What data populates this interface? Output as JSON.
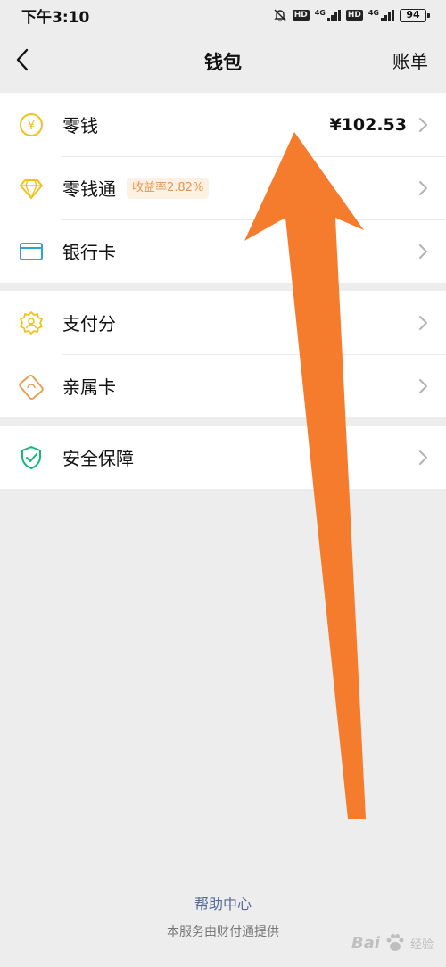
{
  "status_bar": {
    "time": "下午3:10",
    "hd1": "HD",
    "net1": "4G",
    "hd2": "HD",
    "net2": "4G",
    "battery": "94"
  },
  "nav": {
    "title": "钱包",
    "action": "账单"
  },
  "wallet": {
    "change": {
      "label": "零钱",
      "value": "¥102.53",
      "icon": "coin-yen-icon"
    },
    "lct": {
      "label": "零钱通",
      "badge": "收益率2.82%",
      "icon": "diamond-icon"
    },
    "bank_card": {
      "label": "银行卡",
      "icon": "card-icon"
    }
  },
  "services": {
    "pay_score": {
      "label": "支付分",
      "icon": "badge-score-icon"
    },
    "family_card": {
      "label": "亲属卡",
      "icon": "family-card-icon"
    }
  },
  "security": {
    "label": "安全保障",
    "icon": "shield-check-icon"
  },
  "footer": {
    "help": "帮助中心",
    "note": "本服务由财付通提供"
  },
  "watermark": {
    "brand": "Bai",
    "brand2": "经验"
  },
  "colors": {
    "background": "#ededed",
    "annotation_arrow": "#f47c2c",
    "link": "#576b95",
    "coin": "#f2c21a",
    "bank": "#2aa5d6",
    "shield": "#15b87a",
    "badge_text": "#e7954d"
  }
}
